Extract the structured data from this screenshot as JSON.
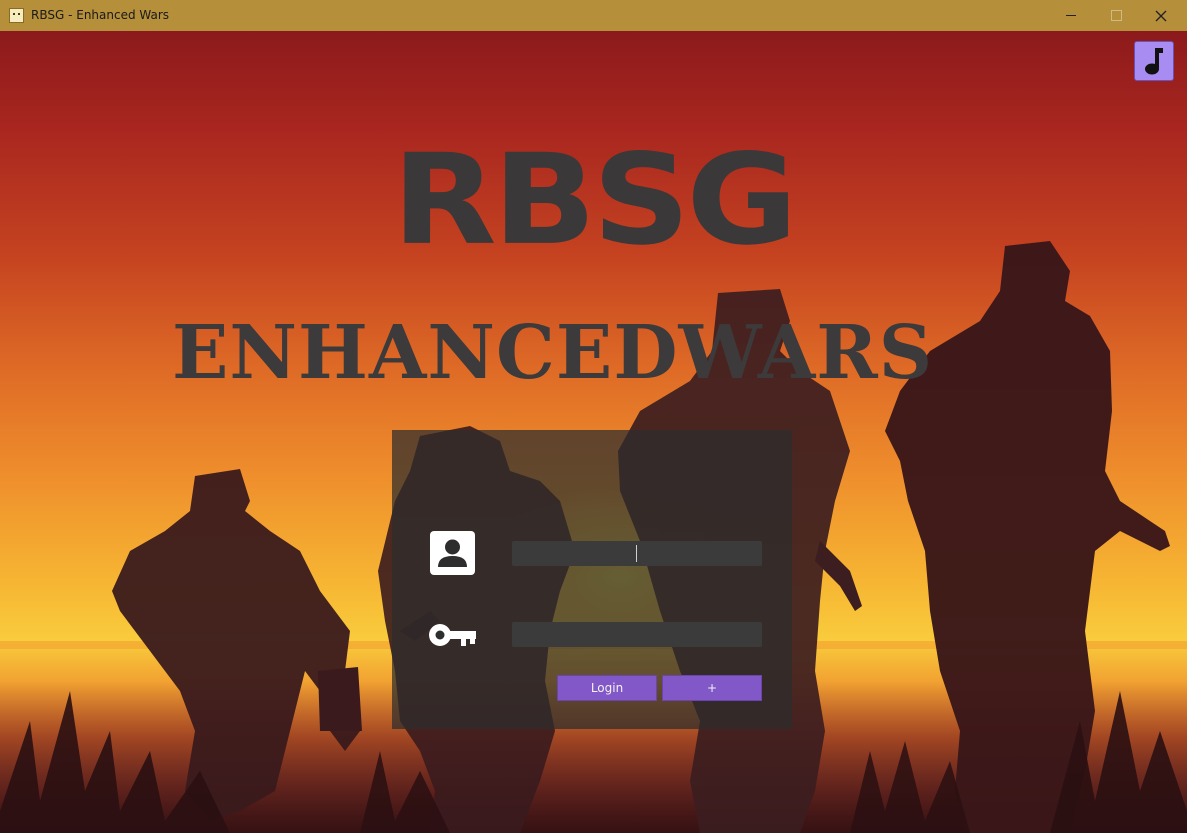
{
  "window": {
    "title": "RBSG - Enhanced Wars",
    "minimize_label": "–",
    "close_label": "✕"
  },
  "logo": {
    "primary": "RBSG",
    "secondary": "ENHANCEDWARS"
  },
  "music": {
    "icon": "music-note-icon",
    "accent": "#a98cf2"
  },
  "login": {
    "username_value": "",
    "password_value": "",
    "user_icon": "user-card-icon",
    "key_icon": "key-icon",
    "login_label": "Login",
    "add_label": "+",
    "button_color": "#8257c8"
  }
}
